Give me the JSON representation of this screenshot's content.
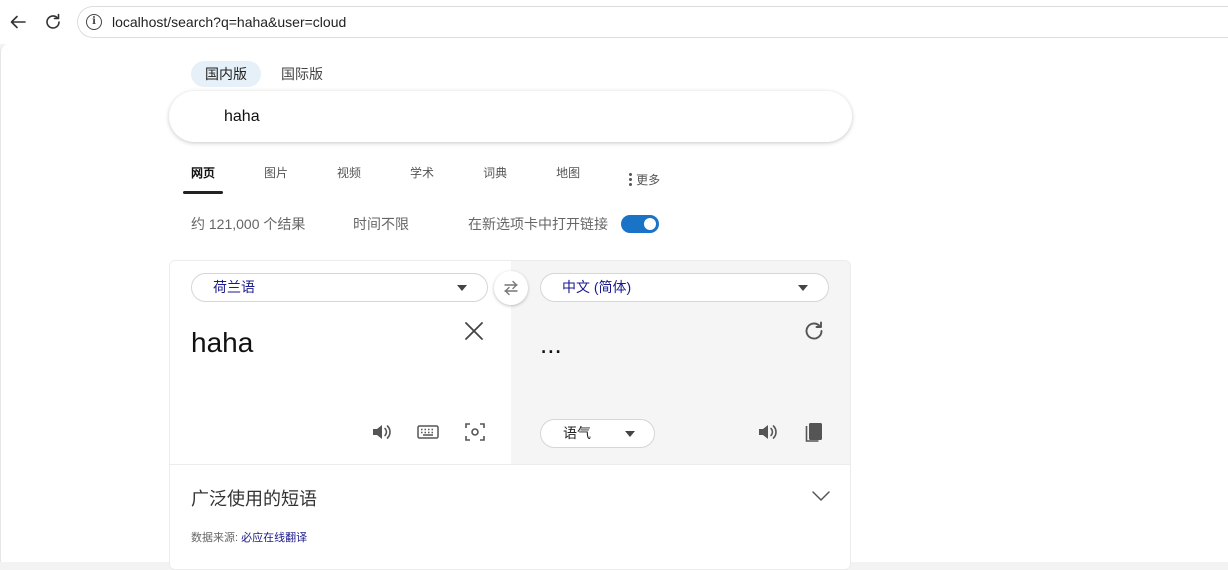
{
  "browser": {
    "url": "localhost/search?q=haha&user=cloud"
  },
  "region_tabs": [
    {
      "label": "国内版",
      "active": true
    },
    {
      "label": "国际版",
      "active": false
    }
  ],
  "search": {
    "query": "haha"
  },
  "scopes": {
    "items": [
      "网页",
      "图片",
      "视频",
      "学术",
      "词典",
      "地图"
    ],
    "more_label": "更多",
    "active_index": 0
  },
  "results_meta": {
    "count": "约 121,000 个结果",
    "time_filter": "时间不限",
    "new_tab_label": "在新选项卡中打开链接",
    "new_tab_enabled": true
  },
  "translator": {
    "source_lang": "荷兰语",
    "target_lang": "中文 (简体)",
    "source_text": "haha",
    "target_text": "...",
    "tone_label": "语气",
    "phrases_title": "广泛使用的短语",
    "source_prefix": "数据来源:",
    "source_link": "必应在线翻译"
  },
  "colors": {
    "toggle_on": "#1a73c7",
    "link": "#1a1a8c",
    "active_tab_bg": "#e6f0f8"
  }
}
